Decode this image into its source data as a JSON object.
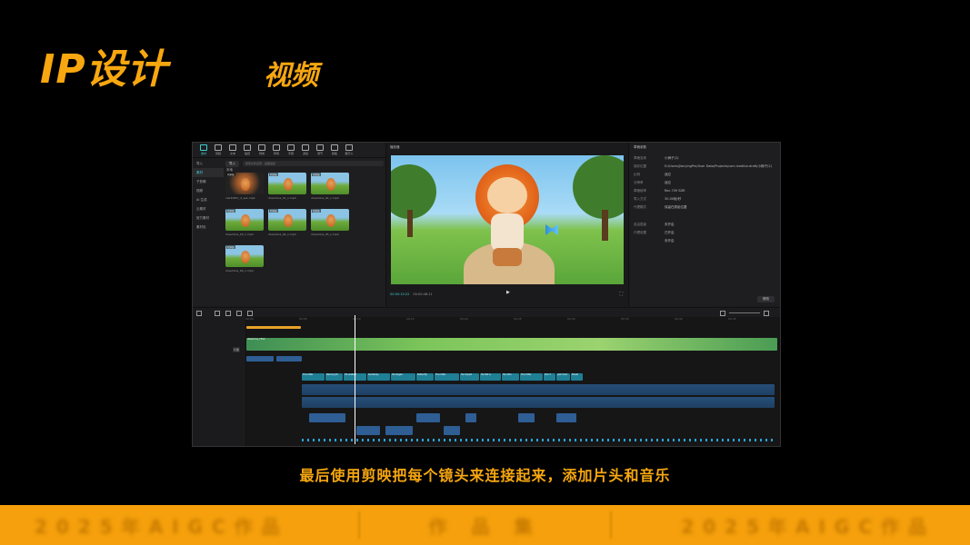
{
  "slide": {
    "title": "IP设计",
    "subtitle": "视频",
    "caption": "最后使用剪映把每个镜头来连接起来，添加片头和音乐",
    "footer": [
      "2025年AIGC作品",
      "作 品 集",
      "2025年AIGC作品"
    ],
    "accent_color": "#f7a70f"
  },
  "app": {
    "toolbar": [
      {
        "label": "素材",
        "icon": "media-icon"
      },
      {
        "label": "音频",
        "icon": "audio-icon"
      },
      {
        "label": "文本",
        "icon": "text-icon"
      },
      {
        "label": "贴纸",
        "icon": "sticker-icon"
      },
      {
        "label": "特效",
        "icon": "effects-icon"
      },
      {
        "label": "转场",
        "icon": "transition-icon"
      },
      {
        "label": "字幕",
        "icon": "caption-icon"
      },
      {
        "label": "滤镜",
        "icon": "filter-icon"
      },
      {
        "label": "调节",
        "icon": "adjust-icon"
      },
      {
        "label": "模板",
        "icon": "template-icon"
      },
      {
        "label": "数字人",
        "icon": "avatar-icon"
      }
    ],
    "media": {
      "sidebar": [
        "导入",
        "素材",
        "子剪辑",
        "视频",
        "AI 生成",
        "云素材",
        "官方素材",
        "素材包"
      ],
      "import_label": "导入",
      "search_placeholder": "搜索文件名称、画面描述",
      "section_label": "本地",
      "clips": [
        {
          "name": "c0a3285c_d_san.mp4",
          "tag": "已添加"
        },
        {
          "name": "dreamina_01_n.mp4",
          "tag": "已添加"
        },
        {
          "name": "dreamina_02_n.mp4",
          "tag": "已添加"
        },
        {
          "name": "dreamina_03_n.mp4",
          "tag": "已添加"
        },
        {
          "name": "dreamina_04_n.mp4",
          "tag": "已添加"
        },
        {
          "name": "dreamina_05_n.mp4",
          "tag": "已添加"
        },
        {
          "name": "dreamina_06_n.mp4",
          "tag": "已添加"
        }
      ]
    },
    "player": {
      "title": "播放器",
      "current_time": "00:00:10:22",
      "total_time": "00:00:48:11"
    },
    "properties": {
      "title": "草稿参数",
      "rows": [
        {
          "k": "草稿名称",
          "v": "小狮子(2)"
        },
        {
          "k": "保存位置",
          "v": "D:/Users/JianyingPro/User Data/Projects/com.lveditor.draft/小狮子(2)"
        },
        {
          "k": "比例",
          "v": "适应"
        },
        {
          "k": "分辨率",
          "v": "适应"
        },
        {
          "k": "草稿帧率",
          "v": "Rec.709 SDR"
        },
        {
          "k": "导入方式",
          "v": "30.00帧/秒"
        },
        {
          "k": "代理模式",
          "v": "保留在原始位置"
        },
        {
          "k": "自由层级",
          "v": "未开启"
        },
        {
          "k": "代理设置",
          "v": "已开启"
        },
        {
          "k": "",
          "v": "未开启"
        }
      ],
      "modify_label": "修改"
    },
    "timeline": {
      "ruler": [
        "00:00",
        "00:05",
        "00:10",
        "00:15",
        "00:20",
        "00:25",
        "00:30",
        "00:35",
        "00:40",
        "00:45"
      ],
      "cover_label": "封面",
      "track_label": "dreamina_7552",
      "caption_clips": [
        "The little",
        "Naming th",
        "He walked",
        "Suddenly",
        "He began",
        "Butterfly",
        "The little",
        "He hoped",
        "He felt a",
        "He didn",
        "The little",
        "Don't",
        "just dont",
        "Brush"
      ]
    }
  }
}
